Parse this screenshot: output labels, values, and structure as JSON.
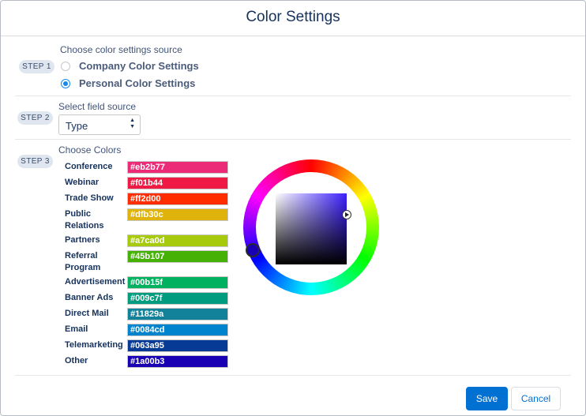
{
  "window": {
    "title": "Color Settings"
  },
  "steps": {
    "step1": {
      "badge": "STEP 1",
      "heading": "Choose color settings source",
      "options": [
        {
          "label": "Company Color Settings",
          "selected": false
        },
        {
          "label": "Personal Color Settings",
          "selected": true
        }
      ]
    },
    "step2": {
      "badge": "STEP 2",
      "heading": "Select field source",
      "select_value": "Type"
    },
    "step3": {
      "badge": "STEP 3",
      "heading": "Choose Colors",
      "colors": [
        {
          "name": "Conference",
          "hex": "#eb2b77"
        },
        {
          "name": "Webinar",
          "hex": "#f01b44"
        },
        {
          "name": "Trade Show",
          "hex": "#ff2d00"
        },
        {
          "name": "Public Relations",
          "hex": "#dfb30c"
        },
        {
          "name": "Partners",
          "hex": "#a7ca0d"
        },
        {
          "name": "Referral Program",
          "hex": "#45b107"
        },
        {
          "name": "Advertisement",
          "hex": "#00b15f"
        },
        {
          "name": "Banner Ads",
          "hex": "#009c7f"
        },
        {
          "name": "Direct Mail",
          "hex": "#11829a"
        },
        {
          "name": "Email",
          "hex": "#0084cd"
        },
        {
          "name": "Telemarketing",
          "hex": "#063a95"
        },
        {
          "name": "Other",
          "hex": "#1a00b3"
        }
      ]
    }
  },
  "picker": {
    "selected_color": "#1a00b3",
    "square_hue_color": "#3d20ff"
  },
  "footer": {
    "save_label": "Save",
    "cancel_label": "Cancel"
  },
  "theme": {
    "accent": "#0070d2",
    "radio_selected": "#1589ee",
    "title_color": "#16325c"
  }
}
